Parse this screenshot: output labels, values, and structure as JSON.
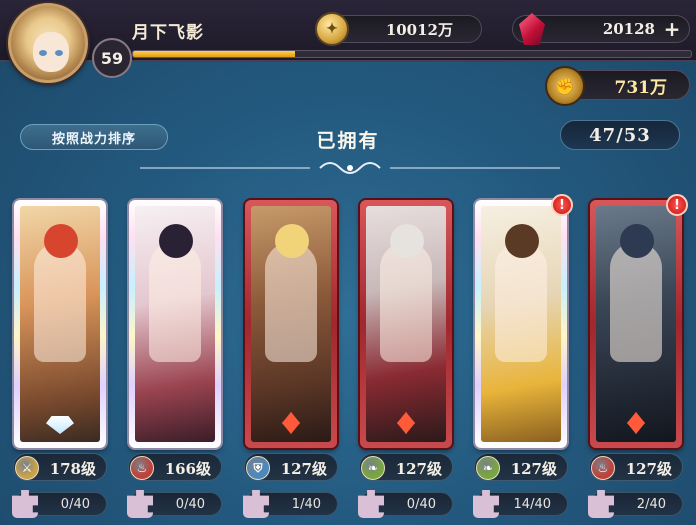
{
  "player": {
    "name": "月下飞影",
    "level": "59",
    "exp_fraction": 0.29
  },
  "resources": {
    "gold": "10012万",
    "gems": "20128",
    "power": "731万",
    "plus_symbol": "+"
  },
  "toolbar": {
    "sort_label": "按照战力排序",
    "title": "已拥有",
    "count": "47/53"
  },
  "colors": {
    "accent_gold": "#e39b16",
    "frame_red": "#a0272d",
    "alert_red": "#c5120f"
  },
  "heroes": [
    {
      "level": "178级",
      "fragments": "0/40",
      "frame": "rainbow",
      "element_icon": "sword-icon",
      "element_color": "#c9a24a",
      "alert": false,
      "rank_gem": "white"
    },
    {
      "level": "166级",
      "fragments": "0/40",
      "frame": "rainbow",
      "element_icon": "flame-icon",
      "element_color": "#c0413a",
      "alert": false,
      "rank_gem": "none"
    },
    {
      "level": "127级",
      "fragments": "1/40",
      "frame": "red",
      "element_icon": "shield-icon",
      "element_color": "#4a88c0",
      "alert": false,
      "rank_gem": "red"
    },
    {
      "level": "127级",
      "fragments": "0/40",
      "frame": "red",
      "element_icon": "leaf-icon",
      "element_color": "#7aa640",
      "alert": false,
      "rank_gem": "red"
    },
    {
      "level": "127级",
      "fragments": "14/40",
      "frame": "rainbow",
      "element_icon": "leaf-icon",
      "element_color": "#7aa640",
      "alert": true,
      "rank_gem": "none"
    },
    {
      "level": "127级",
      "fragments": "2/40",
      "frame": "red",
      "element_icon": "flame-icon",
      "element_color": "#c0413a",
      "alert": true,
      "rank_gem": "red"
    }
  ],
  "alert_symbol": "!"
}
